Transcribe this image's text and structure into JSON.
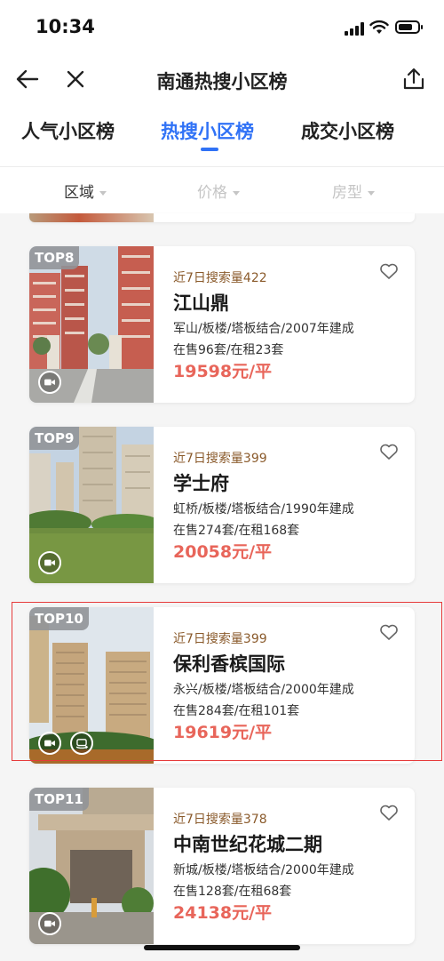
{
  "status_bar": {
    "time": "10:34"
  },
  "navbar": {
    "title": "南通热搜小区榜"
  },
  "tabs": [
    {
      "label": "人气小区榜",
      "active": false
    },
    {
      "label": "热搜小区榜",
      "active": true
    },
    {
      "label": "成交小区榜",
      "active": false
    }
  ],
  "filters": [
    {
      "label": "区域",
      "enabled": true
    },
    {
      "label": "价格",
      "enabled": false
    },
    {
      "label": "房型",
      "enabled": false
    }
  ],
  "listings": [
    {
      "rank": "TOP8",
      "searches": "近7日搜索量422",
      "name": "江山鼎",
      "desc": "军山/板楼/塔板结合/2007年建成",
      "stock": "在售96套/在租23套",
      "price": "19598元/平",
      "media": [
        "video-icon"
      ]
    },
    {
      "rank": "TOP9",
      "searches": "近7日搜索量399",
      "name": "学士府",
      "desc": "虹桥/板楼/塔板结合/1990年建成",
      "stock": "在售274套/在租168套",
      "price": "20058元/平",
      "media": [
        "video-icon"
      ]
    },
    {
      "rank": "TOP10",
      "searches": "近7日搜索量399",
      "name": "保利香槟国际",
      "desc": "永兴/板楼/塔板结合/2000年建成",
      "stock": "在售284套/在租101套",
      "price": "19619元/平",
      "media": [
        "video-icon",
        "vr-icon"
      ]
    },
    {
      "rank": "TOP11",
      "searches": "近7日搜索量378",
      "name": "中南世纪花城二期",
      "desc": "新城/板楼/塔板结合/2000年建成",
      "stock": "在售128套/在租68套",
      "price": "24138元/平",
      "media": [
        "video-icon"
      ]
    }
  ],
  "colors": {
    "accent": "#3072f6",
    "price": "#e8655a",
    "search_count": "#8a5a2b",
    "highlight_box": "#e63a3a"
  }
}
